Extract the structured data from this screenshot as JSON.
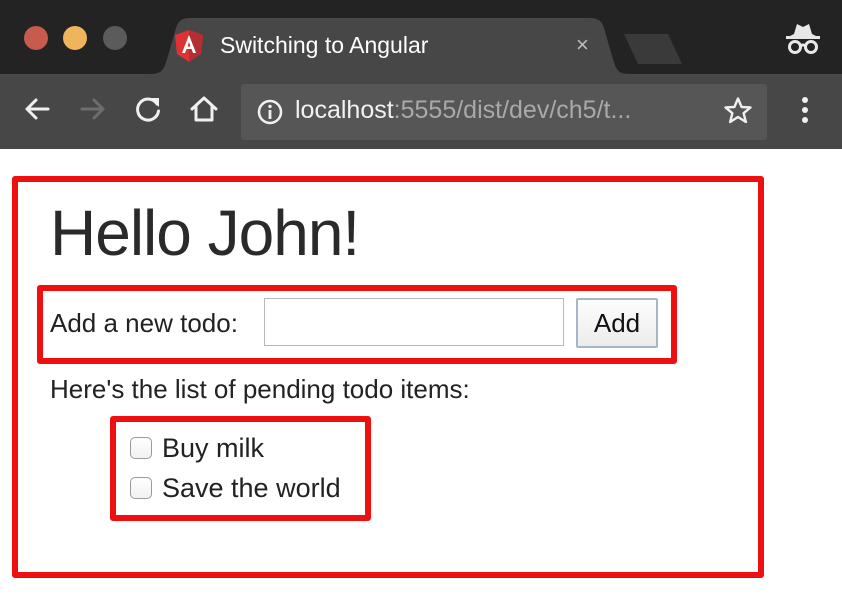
{
  "browser": {
    "tab_title": "Switching to Angular",
    "tab_close": "×",
    "url_host": "localhost",
    "url_rest": ":5555/dist/dev/ch5/t...",
    "icons": {
      "back": "back-arrow-icon",
      "forward": "forward-arrow-icon",
      "reload": "reload-icon",
      "home": "home-icon",
      "info": "info-icon",
      "star": "star-icon",
      "menu": "kebab-menu-icon",
      "incognito": "incognito-icon",
      "favicon": "angular-logo"
    },
    "colors": {
      "titlebar": "#232323",
      "toolbar": "#474747",
      "omnibox": "#565656",
      "close": "#c65b4e",
      "minimize": "#f0b55c",
      "maximize": "#5b5b5b"
    }
  },
  "page": {
    "heading": "Hello John!",
    "form": {
      "label": "Add a new todo:",
      "input_value": "",
      "add_button": "Add"
    },
    "list_heading": "Here's the list of pending todo items:",
    "items": [
      {
        "label": "Buy milk",
        "checked": false
      },
      {
        "label": "Save the world",
        "checked": false
      }
    ],
    "highlight_color": "#ee1010"
  }
}
